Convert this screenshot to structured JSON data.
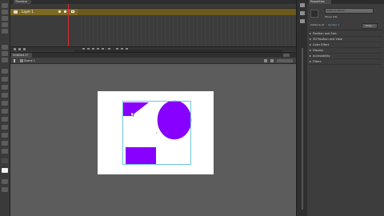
{
  "timeline": {
    "tab_label": "Timeline",
    "layer_name": "Layer 1"
  },
  "document": {
    "tab_label": "Untitled-1*",
    "scene_label": "Scene 1"
  },
  "stage": {
    "shape_color": "#8800ff",
    "selection_color": "#6cc6d8"
  },
  "properties": {
    "tab_label": "Properties",
    "symbol_type": "Instance Name",
    "behavior": "Movie Clip",
    "instance_of_label": "Instance of:",
    "instance_of_value": "Symbol 1",
    "swap_label": "Swap...",
    "sections": [
      "Position and Size",
      "3D Position and View",
      "Color Effect",
      "Display",
      "Accessibility",
      "Filters"
    ]
  },
  "colors": {
    "playhead": "#d2302e",
    "layer_highlight": "#7d6a22"
  }
}
